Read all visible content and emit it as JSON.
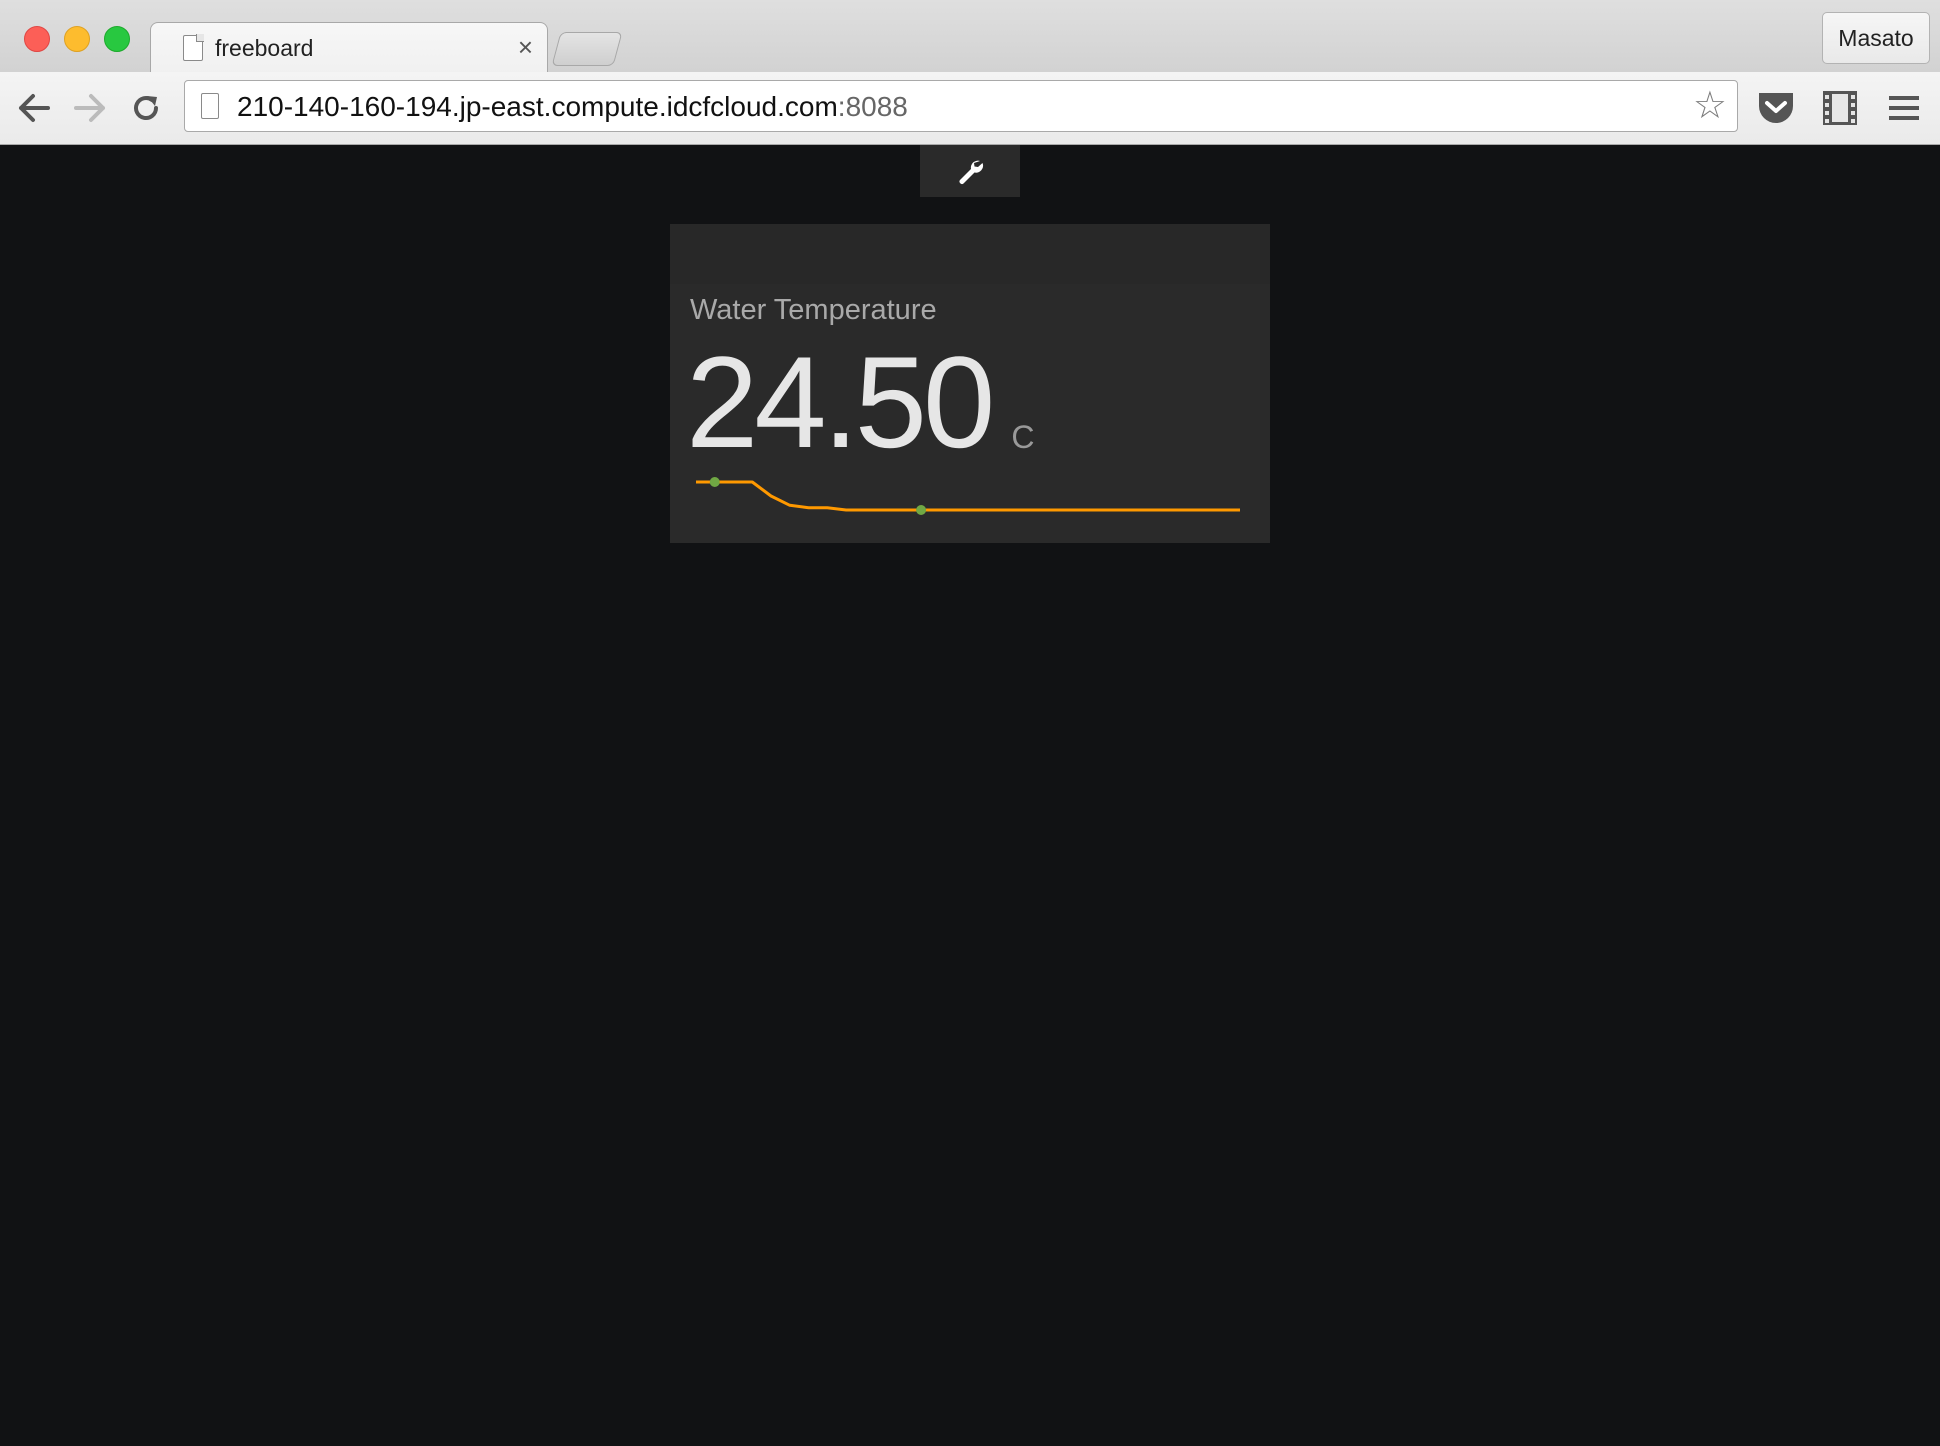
{
  "browser": {
    "tab_title": "freeboard",
    "tab_close": "×",
    "profile_name": "Masato",
    "url_host": "210-140-160-194.jp-east.compute.idcfcloud.com",
    "url_port": ":8088",
    "star_glyph": "☆"
  },
  "dashboard": {
    "admin_icon": "wrench-icon",
    "widget": {
      "title": "Water Temperature",
      "value": "24.50",
      "units": "C",
      "sparkline": {
        "values": [
          25.1,
          25.1,
          25.1,
          25.1,
          24.8,
          24.6,
          24.55,
          24.55,
          24.5,
          24.5,
          24.5,
          24.5,
          24.5,
          24.5,
          24.5,
          24.5,
          24.5,
          24.5,
          24.5,
          24.5,
          24.5,
          24.5,
          24.5,
          24.5,
          24.5,
          24.5,
          24.5,
          24.5,
          24.5,
          24.5
        ],
        "line_color": "#ff9900",
        "marker_color": "#70a844"
      }
    }
  }
}
